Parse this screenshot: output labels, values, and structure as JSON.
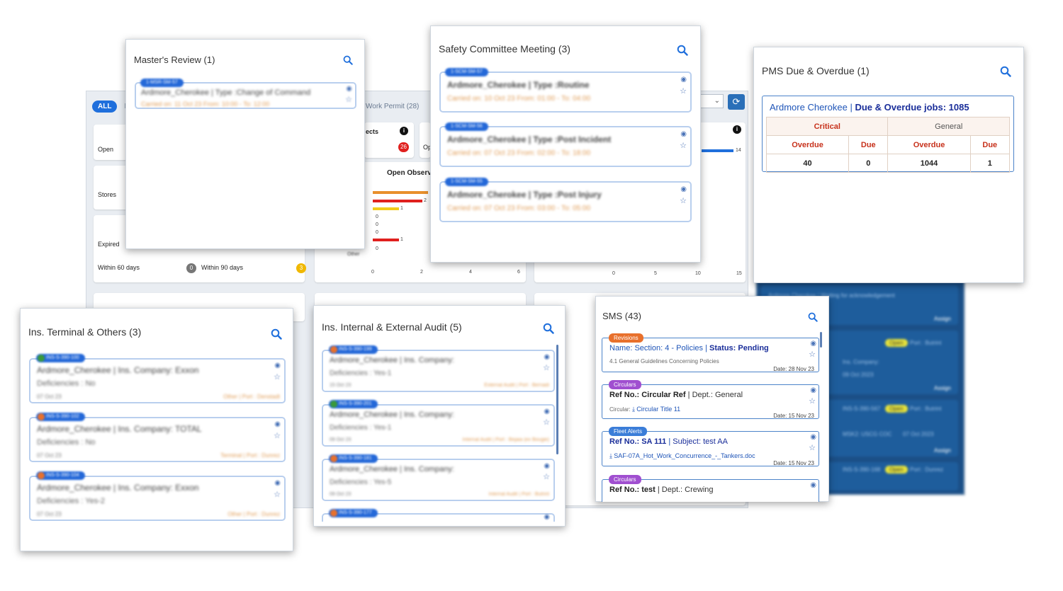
{
  "dashboard": {
    "all_tab": "ALL",
    "tab_ins": "In",
    "tab_work_permit": "Work Permit (28)",
    "label_open": "Open",
    "label_stores": "Stores",
    "label_expired": "Expired",
    "label_within_60": "Within 60 days",
    "badge_60": "0",
    "label_within_90": "Within 90 days",
    "badge_90": "3",
    "defects_label": "ects",
    "defects_badge": "26",
    "op_label": "Op",
    "open_obs_title": "Open Observ",
    "other_label": "Other",
    "chart_ticks_a": [
      "0",
      "2",
      "4",
      "6"
    ],
    "chart_ticks_b": [
      "0",
      "5",
      "10",
      "15"
    ],
    "bar_values": [
      "2",
      "1",
      "0",
      "0",
      "0",
      "1",
      "0"
    ],
    "bar_value_14": "14",
    "colors": {
      "accent": "#1f6fdc",
      "orange": "#e8902c",
      "red": "#e0201e",
      "yellow": "#f2cc1a"
    }
  },
  "masters_review": {
    "title": "Master's Review (1)",
    "items": [
      {
        "tag": "1-MSR-SM-57",
        "line1": "Ardmore_Cherokee | Type :Change of Command",
        "line2": "Carried on: 11 Oct 23 From: 10:00 - To: 12:00"
      }
    ]
  },
  "safety_committee": {
    "title": "Safety Committee Meeting (3)",
    "items": [
      {
        "tag": "1-SCM-SM-57",
        "line1": "Ardmore_Cherokee | Type :Routine",
        "line2": "Carried on: 10 Oct 23 From: 01:00 - To: 04:00"
      },
      {
        "tag": "1-SCM-SM-56",
        "line1": "Ardmore_Cherokee | Type :Post Incident",
        "line2": "Carried on: 07 Oct 23 From: 02:00 - To: 18:00"
      },
      {
        "tag": "1-SCM-SM-55",
        "line1": "Ardmore_Cherokee | Type :Post Injury",
        "line2": "Carried on: 07 Oct 23 From: 03:00 - To: 05:00"
      }
    ]
  },
  "pms": {
    "title": "PMS Due & Overdue (1)",
    "vessel": "Ardmore Cherokee",
    "sep": "|",
    "jobs_label": "Due & Overdue jobs: 1085",
    "critical": "Critical",
    "general": "General",
    "overdue": "Overdue",
    "due": "Due",
    "values": [
      "40",
      "0",
      "1044",
      "1"
    ]
  },
  "ins_terminal": {
    "title": "Ins. Terminal & Others (3)",
    "items": [
      {
        "tag": "INS-S-390-100",
        "dot": "#3a9a3a",
        "line1": "Ardmore_Cherokee | Ins. Company: Exxon",
        "line2": "Deficiencies : No",
        "date": "07 Oct 23",
        "foot": "Other | Port : Denstadt"
      },
      {
        "tag": "INS-S-390-102",
        "dot": "#e8702c",
        "line1": "Ardmore_Cherokee | Ins. Company: TOTAL",
        "line2": "Deficiencies : No",
        "date": "07 Oct 23",
        "foot": "Terminal | Port : Dunrez"
      },
      {
        "tag": "INS-S-390-104",
        "dot": "#e8702c",
        "line1": "Ardmore_Cherokee | Ins. Company: Exxon",
        "line2": "Deficiencies : Yes-2",
        "date": "07 Oct 23",
        "foot": "Other | Port : Dunrez"
      }
    ]
  },
  "ins_audit": {
    "title": "Ins. Internal & External Audit (5)",
    "items": [
      {
        "tag": "INS-S-390-199",
        "dot": "#e8702c",
        "line1": "Ardmore_Cherokee | Ins. Company:",
        "line2": "Deficiencies : Yes-1",
        "date": "15 Oct 23",
        "foot": "External Audit | Port : Bernadi"
      },
      {
        "tag": "INS-S-390-201",
        "dot": "#3a9a3a",
        "line1": "Ardmore_Cherokee | Ins. Company:",
        "line2": "Deficiencies : Yes-1",
        "date": "09 Oct 23",
        "foot": "Internal Audit | Port : Bejaia (ex Bougie)"
      },
      {
        "tag": "INS-S-390-181",
        "dot": "#e8702c",
        "line1": "Ardmore_Cherokee | Ins. Company:",
        "line2": "Deficiencies : Yes-5",
        "date": "09 Oct 23",
        "foot": "Internal Audit | Port : Butrint"
      },
      {
        "tag": "INS-S-390-177",
        "dot": "#e8702c",
        "line1": "",
        "line2": "",
        "date": "",
        "foot": ""
      }
    ]
  },
  "sms": {
    "title": "SMS (43)",
    "items": [
      {
        "tag": "Revisions",
        "tag_color": "#e8702c",
        "line1_a": "Name: Section: 4 - Policies",
        "sep": "|",
        "line1_b": "Status: Pending",
        "line2": "4.1 General Guidelines Concerning Policies",
        "date": "Date: 28 Nov 23"
      },
      {
        "tag": "Circulars",
        "tag_color": "#a04fd0",
        "line1_a": "Ref No.: Circular Ref",
        "sep": "|",
        "line1_b": "Dept.: General",
        "line2_prefix": "Circular:",
        "line2": "Circular Title 11",
        "date": "Date: 15 Nov 23"
      },
      {
        "tag": "Fleet Alerts",
        "tag_color": "#3b7dd8",
        "line1_a": "Ref No.: SA 111",
        "sep": "|",
        "line1_b": "Subject: test AA",
        "line2": "SAF-07A_Hot_Work_Concurrence_-_Tankers.doc",
        "date": "Date: 15 Nov 23"
      },
      {
        "tag": "Circulars",
        "tag_color": "#a04fd0",
        "line1_a": "Ref No.: test",
        "sep": "|",
        "line1_b": "Dept.: Crewing"
      }
    ]
  },
  "blue_panel": {
    "items": [
      {
        "line": "Ardmore Cherokee | Waiting for acknowledgement",
        "assign": "Assign"
      },
      {
        "pill": "Open",
        "line": "Port : Butrint",
        "sub": "Ins. Company:",
        "sub2": "09 Oct 2023",
        "assign": "Assign"
      },
      {
        "pill": "Open",
        "line": "Port : Butrint",
        "tag": "INS-S-390-567",
        "sub": "MSK2: USCG COC",
        "sub2": "07 Oct 2023",
        "assign": "Assign"
      },
      {
        "pill": "Open",
        "line": "Port : Dunrez",
        "tag": "INS-S-390-168"
      }
    ]
  },
  "icons": {
    "search": "search-icon",
    "eye": "eye-icon",
    "star": "star-icon",
    "info": "info-icon",
    "refresh": "refresh-icon"
  }
}
